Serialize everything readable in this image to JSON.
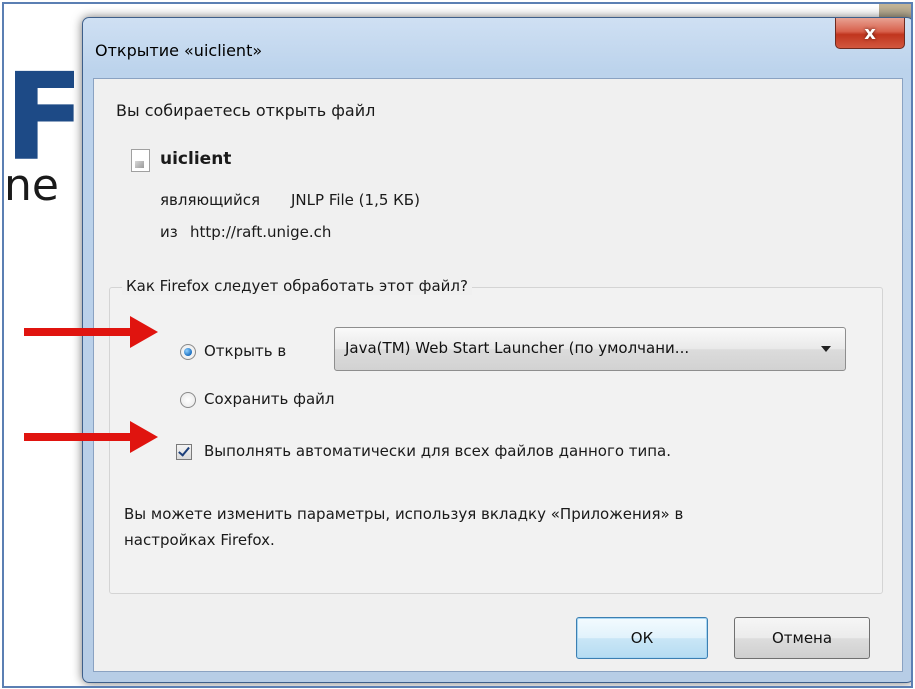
{
  "window": {
    "title": "Открытие «uiclient»",
    "close_glyph": "x"
  },
  "file": {
    "intro": "Вы собираетесь открыть файл",
    "name": "uiclient",
    "type_label": "являющийся",
    "type_value": "JNLP File (1,5 КБ)",
    "from_label": "из",
    "from_value": "http://raft.unige.ch"
  },
  "action": {
    "question": "Как Firefox следует обработать этот файл?",
    "open_with_label": "Открыть в",
    "open_with_selected": true,
    "app_selected": "Java(TM) Web Start Launcher (по умолчани...",
    "save_label": "Сохранить файл",
    "save_selected": false,
    "auto_label": "Выполнять автоматически для всех файлов данного типа.",
    "auto_checked": true
  },
  "hint": {
    "line1": "Вы можете изменить параметры, используя вкладку «Приложения» в",
    "line2": "настройках Firefox."
  },
  "buttons": {
    "ok": "ОК",
    "cancel": "Отмена"
  },
  "background": {
    "logo_glyph": "F",
    "text_fragment": "ne"
  },
  "colors": {
    "annotation_arrow": "#e0140f",
    "logo_dark": "#1d4a86",
    "logo_light": "#5a8ccd"
  },
  "icons": {
    "file": "file-icon",
    "close": "close-icon",
    "dropdown": "chevron-down-icon"
  }
}
